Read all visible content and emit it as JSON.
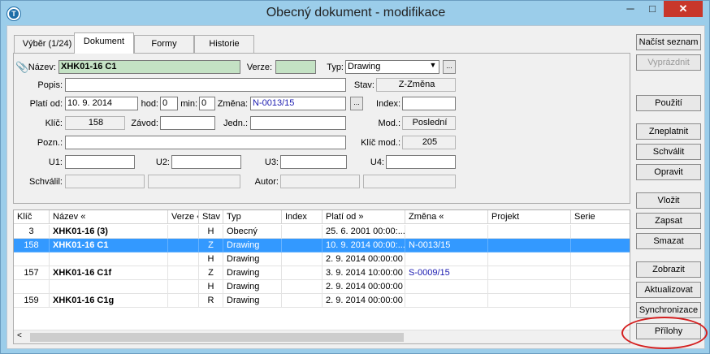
{
  "window": {
    "title": "Obecný dokument - modifikace",
    "min": "─",
    "max": "□",
    "close": "✕"
  },
  "tabs": [
    "Výběr (1/24)",
    "Dokument",
    "Formy",
    "Historie"
  ],
  "form": {
    "nazev_label": "Název:",
    "nazev": "XHK01-16 C1",
    "verze_label": "Verze:",
    "verze": "",
    "typ_label": "Typ:",
    "typ": "Drawing",
    "popis_label": "Popis:",
    "popis": "",
    "stav_label": "Stav:",
    "stav": "Z-Změna",
    "plati_od_label": "Platí od:",
    "plati_od": "10. 9. 2014",
    "hod_label": "hod:",
    "hod": "0",
    "min_label": "min:",
    "min": "0",
    "zmena_label": "Změna:",
    "zmena": "N-0013/15",
    "index_label": "Index:",
    "index": "",
    "klic_label": "Klíč:",
    "klic": "158",
    "zavod_label": "Závod:",
    "zavod": "",
    "jedn_label": "Jedn.:",
    "jedn": "",
    "mod_label": "Mod.:",
    "mod": "Poslední",
    "pozn_label": "Pozn.:",
    "pozn": "",
    "klic_mod_label": "Klíč mod.:",
    "klic_mod": "205",
    "u1_label": "U1:",
    "u2_label": "U2:",
    "u3_label": "U3:",
    "u4_label": "U4:",
    "schvalil_label": "Schválil:",
    "autor_label": "Autor:",
    "ellipsis": "..."
  },
  "grid": {
    "headers": [
      "Klíč",
      "Název «",
      "Verze «",
      "Stav",
      "Typ",
      "Index",
      "Platí od »",
      "Změna «",
      "Projekt",
      "Serie"
    ],
    "rows": [
      {
        "klic": "3",
        "nazev": "XHK01-16 (3)",
        "stav": "H",
        "typ": "Obecný",
        "plati": "25. 6. 2001 00:00:...",
        "zmena": ""
      },
      {
        "klic": "158",
        "nazev": "XHK01-16 C1",
        "stav": "Z",
        "typ": "Drawing",
        "plati": "10. 9. 2014 00:00:...",
        "zmena": "N-0013/15"
      },
      {
        "klic": "",
        "nazev": "",
        "stav": "H",
        "typ": "Drawing",
        "plati": "2. 9. 2014 00:00:00",
        "zmena": ""
      },
      {
        "klic": "157",
        "nazev": "XHK01-16 C1f",
        "stav": "Z",
        "typ": "Drawing",
        "plati": "3. 9. 2014 10:00:00",
        "zmena": "S-0009/15"
      },
      {
        "klic": "",
        "nazev": "",
        "stav": "H",
        "typ": "Drawing",
        "plati": "2. 9. 2014 00:00:00",
        "zmena": ""
      },
      {
        "klic": "159",
        "nazev": "XHK01-16 C1g",
        "stav": "R",
        "typ": "Drawing",
        "plati": "2. 9. 2014 00:00:00",
        "zmena": ""
      }
    ]
  },
  "buttons": [
    "Načíst seznam",
    "Vyprázdnit",
    "Použití",
    "Zneplatnit",
    "Schválit",
    "Opravit",
    "Vložit",
    "Zapsat",
    "Smazat",
    "Zobrazit",
    "Aktualizovat",
    "Synchronizace",
    "Přílohy"
  ],
  "colors": {
    "selected_row": "#3399ff",
    "name_field": "#c4e2c4",
    "highlight_oval": "#d42020"
  }
}
